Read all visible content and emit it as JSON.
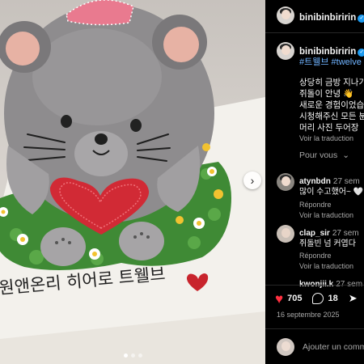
{
  "post": {
    "cake_text": "원앤온리 히어로 트웰브",
    "carousel": {
      "dots": 3,
      "active_index": 0
    }
  },
  "header": {
    "username": "binibinbiririn",
    "verified": true,
    "more_glyph": "···"
  },
  "caption": {
    "username": "binibinbiririn",
    "hashtags": "#트웰브 #twelve",
    "lines": [
      "상당히 금방 지나가",
      "쥐돌이 안녕 👋",
      "새로운 경험이었습",
      "시청해주신 모든 분",
      "머리 사진 두어장 "
    ],
    "translate": "Voir la traduction"
  },
  "for_you": "Pour vous",
  "comments": [
    {
      "username": "atynbdn",
      "time": "27 sem",
      "text": "많이 수고했어~ 🤍",
      "reply": "Répondre",
      "more": "Voir la traduction"
    },
    {
      "username": "clap_sir",
      "time": "27 sem",
      "text": "쥐돌빈 넘 커엽다",
      "reply": "Répondre",
      "more": "Voir la traduction"
    },
    {
      "username": "kwonjii.k",
      "time": "27 sem",
      "text": ""
    }
  ],
  "actions": {
    "likes": "705",
    "comments": "18",
    "icons": [
      "heart-icon",
      "comment-icon",
      "share-icon"
    ]
  },
  "date": "16 septembre 2025",
  "add_comment_placeholder": "Ajouter un comm",
  "colors": {
    "like_red": "#ff3040",
    "link_blue": "#6fb3ff",
    "verified_blue": "#1d9bf0",
    "cake_grey": "#8e8c8e",
    "frosting_green": "#3f8a35"
  }
}
